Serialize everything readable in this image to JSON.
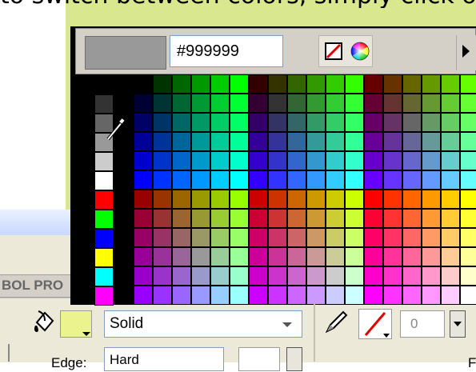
{
  "top_text": "to switch between colors, simply click on the color.",
  "picker": {
    "hex_value": "#999999",
    "preview_color": "#999999",
    "no_color_icon": "no-color-icon",
    "wheel_icon": "color-wheel-icon",
    "menu_icon": "options-menu-arrow-icon",
    "left_swatches": [
      "#333333",
      "#666666",
      "#999999",
      "#cccccc",
      "#ffffff",
      "#ff0000",
      "#00ff00",
      "#0000ff",
      "#ffff00",
      "#00ffff",
      "#ff00ff"
    ]
  },
  "panel": {
    "title": "BOL PRO",
    "fill_style": "Solid",
    "stroke_value": "0",
    "edge_label": "Edge:",
    "edge_value": "Hard",
    "right_letter": "F"
  },
  "colors": {
    "fill_swatch": "#eaf38e",
    "stage_bg": "#d9e88e"
  }
}
